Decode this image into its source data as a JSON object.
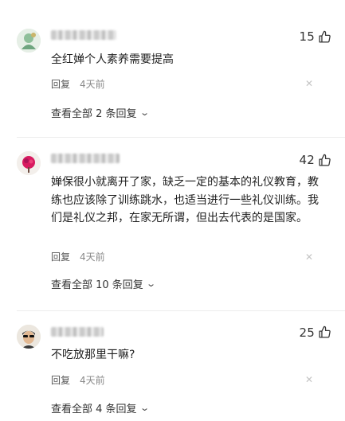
{
  "comments": [
    {
      "likes": "15",
      "text": "全红婵个人素养需要提高",
      "reply_label": "回复",
      "time": "4天前",
      "view_replies": "查看全部 2 条回复",
      "avatar_colors": {
        "bg": "#dfe9e0",
        "fg": "#6fa57f"
      }
    },
    {
      "likes": "42",
      "text": "婵保很小就离开了家，缺乏一定的基本的礼仪教育，教练也应该除了训练跳水，也适当进行一些礼仪训练。我们是礼仪之邦，在家无所谓，但出去代表的是国家。",
      "reply_label": "回复",
      "time": "4天前",
      "view_replies": "查看全部 10 条回复",
      "avatar_colors": {
        "bg": "#f1ece8",
        "fg": "#c2185b"
      }
    },
    {
      "likes": "25",
      "text": "不吃放那里干嘛?",
      "reply_label": "回复",
      "time": "4天前",
      "view_replies": "查看全部 4 条回复",
      "avatar_colors": {
        "bg": "#e9e4dc",
        "fg": "#2b2b2b"
      }
    }
  ],
  "icons": {
    "thumb": "thumbs-up-icon",
    "close": "close-icon",
    "chevron": "chevron-down-icon"
  }
}
